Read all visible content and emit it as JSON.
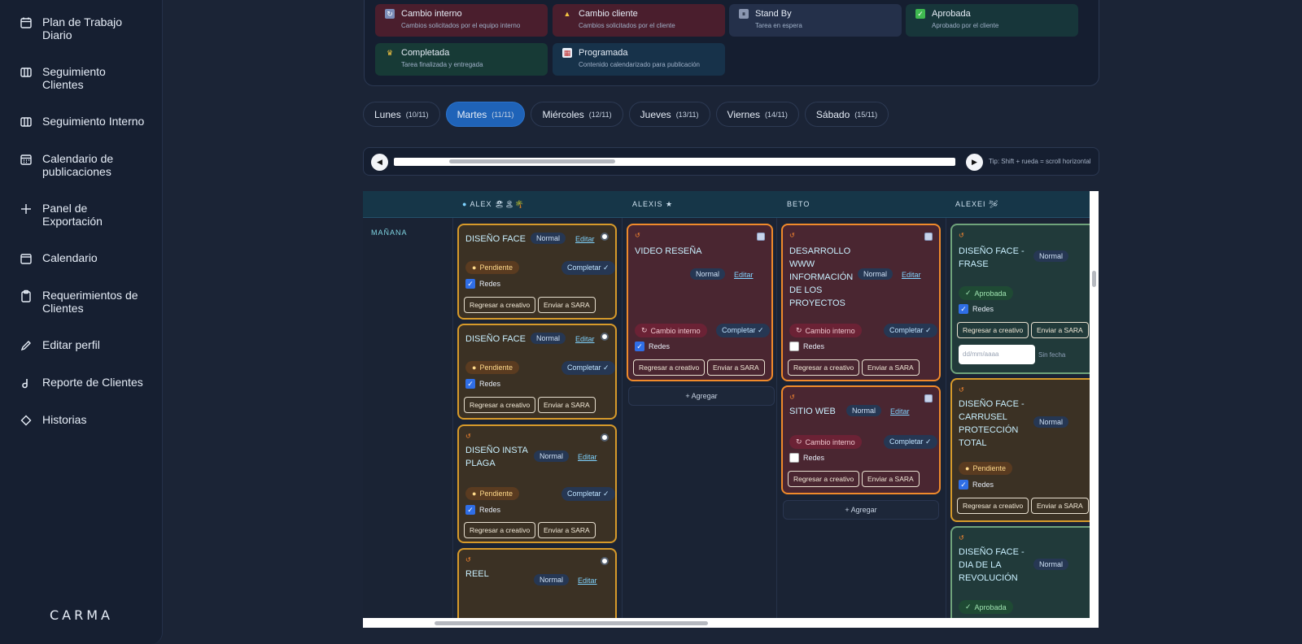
{
  "sidebar": {
    "items": [
      {
        "label": "Plan de Trabajo Diario",
        "icon": "calendar-icon"
      },
      {
        "label": "Seguimiento Clientes",
        "icon": "columns-icon"
      },
      {
        "label": "Seguimiento Interno",
        "icon": "columns-icon"
      },
      {
        "label": "Calendario de publicaciones",
        "icon": "calendar-grid-icon"
      },
      {
        "label": "Panel de Exportación",
        "icon": "plus-icon"
      },
      {
        "label": "Calendario",
        "icon": "calendar-icon"
      },
      {
        "label": "Requerimientos de Clientes",
        "icon": "clipboard-icon"
      },
      {
        "label": "Editar perfil",
        "icon": "pencil-icon"
      },
      {
        "label": "Reporte de Clientes",
        "icon": "report-icon"
      },
      {
        "label": "Historias",
        "icon": "diamond-icon"
      }
    ],
    "logo": "CARMA"
  },
  "statuses": [
    {
      "name": "Cambio interno",
      "desc": "Cambios solicitados por el equipo interno",
      "icon": "refresh-icon"
    },
    {
      "name": "Cambio cliente",
      "desc": "Cambios solicitados por el cliente",
      "icon": "warning-icon"
    },
    {
      "name": "Stand By",
      "desc": "Tarea en espera",
      "icon": "pause-icon"
    },
    {
      "name": "Aprobada",
      "desc": "Aprobado por el cliente",
      "icon": "check-icon"
    },
    {
      "name": "Completada",
      "desc": "Tarea finalizada y entregada",
      "icon": "trophy-icon"
    },
    {
      "name": "Programada",
      "desc": "Contenido calendarizado para publicación",
      "icon": "calendar-icon"
    }
  ],
  "days": [
    {
      "name": "Lunes",
      "date": "(10/11)"
    },
    {
      "name": "Martes",
      "date": "(11/11)"
    },
    {
      "name": "Miércoles",
      "date": "(12/11)"
    },
    {
      "name": "Jueves",
      "date": "(13/11)"
    },
    {
      "name": "Viernes",
      "date": "(14/11)"
    },
    {
      "name": "Sábado",
      "date": "(15/11)"
    }
  ],
  "scroll": {
    "tip": "Tip: Shift + rueda = scroll horizontal"
  },
  "board": {
    "shift": "MAÑANA",
    "columns": [
      "ALEX 🏖🏝🌴",
      "ALEXIS ★",
      "BETO",
      "ALEXEI 🛩"
    ],
    "add_label": "+ Agregar",
    "labels": {
      "normal": "Normal",
      "edit": "Editar",
      "complete": "Completar ✓",
      "redes": "Redes",
      "back": "Regresar a creativo",
      "send": "Enviar a SARA",
      "pending": "Pendiente",
      "cambio_interno": "Cambio interno",
      "aprobada": "Aprobada",
      "date_placeholder": "dd/mm/aaaa",
      "no_date": "Sin fecha"
    },
    "cards": {
      "c1": "DISEÑO FACE",
      "c2": "DISEÑO FACE",
      "c3": "DISEÑO INSTA PLAGA",
      "c4": "REEL",
      "c5": "VIDEO RESEÑA",
      "c6": "DESARROLLO WWW INFORMACIÓN DE LOS PROYECTOS",
      "c7": "SITIO WEB",
      "c8": "DISEÑO FACE - FRASE",
      "c9": "DISEÑO FACE - CARRUSEL PROTECCIÓN TOTAL",
      "c10": "DISEÑO FACE - DIA DE LA REVOLUCIÓN"
    }
  }
}
